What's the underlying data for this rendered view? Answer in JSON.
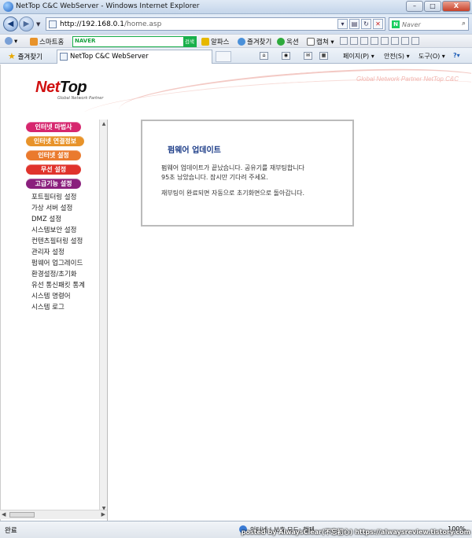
{
  "window": {
    "title": "NetTop C&C WebServer - Windows Internet Explorer",
    "buttons": {
      "minimize": "–",
      "maximize": "□",
      "close": "X"
    }
  },
  "address": {
    "url_host": "http://192.168.0.1",
    "url_path": "/home.asp",
    "search_placeholder": "Naver"
  },
  "toolbar": {
    "smart_home": "스마트홈",
    "naver_brand": "NAVER",
    "naver_go": "검색",
    "alpas": "알파스",
    "favorites": "즐겨찾기",
    "options": "옥션",
    "capture": "캡쳐"
  },
  "favbar": {
    "favorites": "즐겨찾기",
    "tab_label": "NetTop C&C WebServer",
    "page_menu": "페이지(P)",
    "safety_menu": "안전(S)",
    "tools_menu": "도구(O)"
  },
  "banner": {
    "logo_net": "Net",
    "logo_top": "Top",
    "logo_sub": "Global Network Partner",
    "tagline": "Global Network Partner NetTop C&C"
  },
  "sidebar": {
    "main_menu": [
      {
        "label": "인터넷 마법사",
        "color": "#d6266e"
      },
      {
        "label": "인터넷 연결정보",
        "color": "#e8932a"
      },
      {
        "label": "인터넷 설정",
        "color": "#ea7a2e"
      },
      {
        "label": "무선 설정",
        "color": "#e0332c"
      },
      {
        "label": "고급기능 설정",
        "color": "#8a1f7d"
      }
    ],
    "sub_menu": [
      "포트필터링 설정",
      "가상 서버 설정",
      "DMZ 설정",
      "시스템보안 설정",
      "컨텐츠필터링 설정",
      "관리자 설정",
      "펌웨어 업그레이드",
      "환경설정/초기화",
      "유선 통신패킷 통계",
      "시스템 명령어",
      "시스템 로그"
    ]
  },
  "notice": {
    "title": "펌웨어 업데이트",
    "line1": "펌웨어 업데이트가 끝났습니다. 공유기를 재부팅합니다",
    "line2": "95초 남았습니다. 잠시만 기다려 주세요.",
    "line3": "재부팅이 완료되면 자동으로 초기화면으로 돌아갑니다."
  },
  "status": {
    "text": "완료",
    "zone": "인터넷 | 보호 모드: 해제",
    "zoom": "100%",
    "watermark": "posted by AlwaysClear(不忘初心) https://alwaysreview.tistory.com"
  }
}
